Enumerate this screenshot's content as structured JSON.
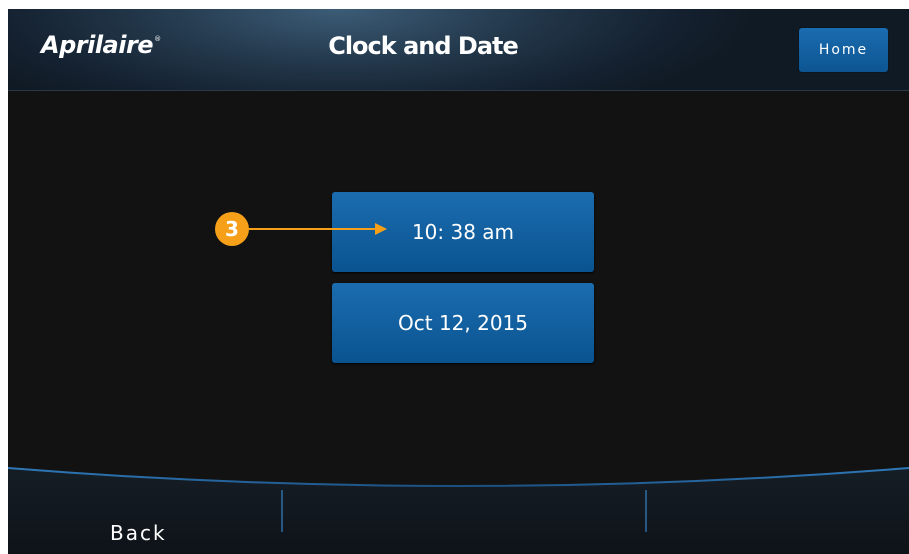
{
  "header": {
    "logo": "Aprilaire",
    "logo_mark": "®",
    "title": "Clock and Date",
    "home_label": "Home"
  },
  "main": {
    "time_value": "10: 38 am",
    "date_value": "Oct 12, 2015",
    "callout_number": "3"
  },
  "footer": {
    "back_label": "Back"
  },
  "colors": {
    "button_blue": "#1565a6",
    "callout_orange": "#f6a01a",
    "background": "#121212",
    "accent_line": "#3d8fd0"
  }
}
